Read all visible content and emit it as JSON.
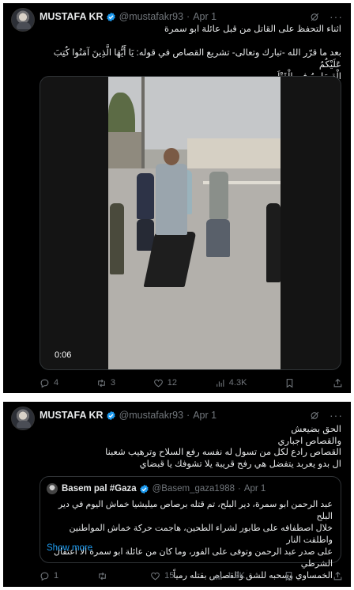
{
  "tweet1": {
    "name": "MUSTAFA KR",
    "handle": "@mustafakr93",
    "separator": "·",
    "date": "Apr 1",
    "line1": "اثناء التحفظ على القاتل من قبل عائلة ابو سمرة",
    "body_line1": "بعد ما قرّر الله -تبارك وتعالى- تشريع القصاص في قوله: يَا أَيُّهَا الَّذِينَ آمَنُوا كُتِبَ عَلَيْكُمُ",
    "body_line2": "الْقِصَاصُ فِي الْقَتْلَى",
    "video_duration": "0:06",
    "stats": {
      "replies": "4",
      "reposts": "3",
      "likes": "12",
      "views": "4.3K"
    }
  },
  "tweet2": {
    "name": "MUSTAFA KR",
    "handle": "@mustafakr93",
    "separator": "·",
    "date": "Apr 1",
    "lines": [
      "الحق بضيعش",
      "والقصاص اجباري",
      "القصاص رادع لكل من تسول له نفسه رفع السلاح وترهيب شعبنا",
      "ال بدو يعربد يتفضل هي رفح قريبة يلا تشوفك يا قبضاي"
    ],
    "quote": {
      "name": "Basem pal #Gaza",
      "handle": "@Basem_gaza1988",
      "separator": "·",
      "date": "Apr 1",
      "lines": [
        "عبد الرحمن ابو سمرة، دير البلح، تم قتله برصاص ميليشيا خماش اليوم في دير البلح",
        "خلال اصطفافه على طابور لشراء الطحين، هاجمت حركة خماش المواطنين واطلقت النار",
        "على صدر عبد الرحمن وتوفى على الفور، وما كان من عائلة ابو سمرة الا اعتقال الشرطي",
        "الخمساوي وسحبه للشق والقصاص بقتله رمياً"
      ],
      "show_more": "Show more"
    },
    "stats": {
      "replies": "1",
      "reposts": "",
      "likes": "15",
      "views": "1.2K"
    }
  },
  "colors": {
    "background": "#000000",
    "text": "#e7e9ea",
    "muted": "#71767b",
    "accent": "#1d9bf0"
  }
}
